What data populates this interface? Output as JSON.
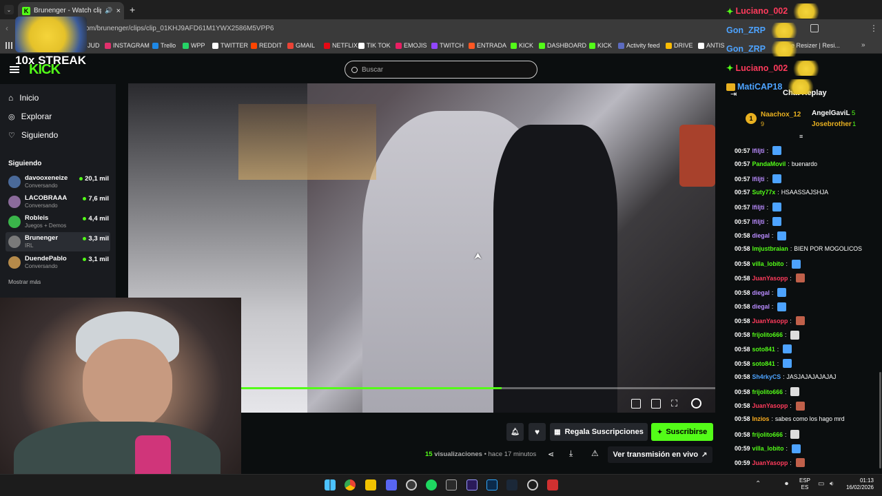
{
  "browser": {
    "tab_title": "Brunenger - Watch clips o",
    "url": "om/brunenger/clips/clip_01KHJ9AFD61M1YWX2586M5VPP6",
    "bookmarks": [
      {
        "label": "JUD",
        "color": "#f5c518"
      },
      {
        "label": "INSTAGRAM",
        "color": "#e1306c"
      },
      {
        "label": "Trello",
        "color": "#1e88e5"
      },
      {
        "label": "WPP",
        "color": "#25d366"
      },
      {
        "label": "TWITTER",
        "color": "#ffffff"
      },
      {
        "label": "REDDIT",
        "color": "#ff4500"
      },
      {
        "label": "GMAIL",
        "color": "#ea4335"
      },
      {
        "label": "NETFLIX",
        "color": "#e50914"
      },
      {
        "label": "TIK TOK",
        "color": "#ffffff"
      },
      {
        "label": "EMOJIS",
        "color": "#e91e63"
      },
      {
        "label": "TWITCH",
        "color": "#9146ff"
      },
      {
        "label": "ENTRADA",
        "color": "#ff5722"
      },
      {
        "label": "KICK",
        "color": "#53fc18"
      },
      {
        "label": "DASHBOARD",
        "color": "#53fc18"
      },
      {
        "label": "KICK",
        "color": "#53fc18"
      },
      {
        "label": "Activity feed",
        "color": "#5c6bc0"
      },
      {
        "label": "DRIVE",
        "color": "#fbbc04"
      },
      {
        "label": "ANTIS",
        "color": "#ffffff"
      },
      {
        "label": "e Resizer | Resi...",
        "color": "#9e9e9e"
      }
    ]
  },
  "overlay": {
    "streak": "10x STREAK",
    "chatters": [
      {
        "name": "Luciano_002",
        "color": "#ff3b5c",
        "icon": "sparkle-icon"
      },
      {
        "name": "Gon_ZRP",
        "color": "#4da3ff",
        "icon": ""
      },
      {
        "name": "Gon_ZRP",
        "color": "#4da3ff",
        "icon": ""
      },
      {
        "name": "Luciano_002",
        "color": "#ff3b5c",
        "icon": "sparkle-icon"
      },
      {
        "name": "MatiCAP18",
        "color": "#4da3ff",
        "icon": "crown-icon"
      }
    ]
  },
  "kick": {
    "logo": "KICK",
    "search_placeholder": "Buscar",
    "nav": [
      {
        "label": "Inicio",
        "icon": "home-icon"
      },
      {
        "label": "Explorar",
        "icon": "compass-icon"
      },
      {
        "label": "Siguiendo",
        "icon": "heart-icon"
      }
    ],
    "following_title": "Siguiendo",
    "channels": [
      {
        "name": "davooxeneize",
        "sub": "Conversando",
        "viewers": "20,1 mil",
        "color": "#4a6a9a"
      },
      {
        "name": "LACOBRAAA",
        "sub": "Conversando",
        "viewers": "7,6 mil",
        "color": "#8a6a9a"
      },
      {
        "name": "Robleis",
        "sub": "Juegos + Demos",
        "viewers": "4,4 mil",
        "color": "#3ab54a"
      },
      {
        "name": "Brunenger",
        "sub": "IRL",
        "viewers": "3,3 mil",
        "color": "#7a7a7a"
      },
      {
        "name": "DuendePablo",
        "sub": "Conversando",
        "viewers": "3,1 mil",
        "color": "#b58a4a"
      }
    ],
    "show_more": "Mostrar más",
    "gift_label": "Regala Suscripciones",
    "subscribe_label": "Suscribirse",
    "views_count": "15",
    "views_label": "visualizaciones",
    "time_ago": "• hace 17 minutos",
    "watch_live": "Ver transmisión en vivo",
    "clip_progress": 0.55
  },
  "chat": {
    "title": "Chat Replay",
    "leaders": [
      {
        "rank": "1",
        "name": "Naachox_12",
        "count": "9"
      },
      {
        "name": "AngelGaviL",
        "count": "5"
      },
      {
        "name": "Josebrother",
        "count": "1"
      }
    ],
    "messages": [
      {
        "time": "00:57",
        "user": "lfiljti",
        "color": "#b98bff",
        "text": "",
        "emote": "#4da3ff"
      },
      {
        "time": "00:57",
        "user": "PandaMovil",
        "color": "#53fc18",
        "text": "buenardo",
        "emote": ""
      },
      {
        "time": "00:57",
        "user": "lfiljti",
        "color": "#b98bff",
        "text": "",
        "emote": "#4da3ff"
      },
      {
        "time": "00:57",
        "user": "Suty77x",
        "color": "#53fc18",
        "text": "HSAASSAJSHJA",
        "emote": ""
      },
      {
        "time": "00:57",
        "user": "lfiljti",
        "color": "#b98bff",
        "text": "",
        "emote": "#4da3ff"
      },
      {
        "time": "00:57",
        "user": "lfiljti",
        "color": "#b98bff",
        "text": "",
        "emote": "#4da3ff"
      },
      {
        "time": "00:58",
        "user": "diegal",
        "color": "#b98bff",
        "text": "",
        "emote": "#4da3ff"
      },
      {
        "time": "00:58",
        "user": "lmjustbraian",
        "color": "#53fc18",
        "text": "BIEN POR MOGOLICOS",
        "emote": ""
      },
      {
        "time": "00:58",
        "user": "villa_lobito",
        "color": "#53fc18",
        "text": "",
        "emote": "#4da3ff"
      },
      {
        "time": "00:58",
        "user": "JuanYasopp",
        "color": "#ff3b5c",
        "text": "",
        "emote": "#c0604a"
      },
      {
        "time": "00:58",
        "user": "diegal",
        "color": "#b98bff",
        "text": "",
        "emote": "#4da3ff"
      },
      {
        "time": "00:58",
        "user": "diegal",
        "color": "#b98bff",
        "text": "",
        "emote": "#4da3ff"
      },
      {
        "time": "00:58",
        "user": "JuanYasopp",
        "color": "#ff3b5c",
        "text": "",
        "emote": "#c0604a"
      },
      {
        "time": "00:58",
        "user": "frijolito666",
        "color": "#53fc18",
        "text": "",
        "emote": "#dddddd"
      },
      {
        "time": "00:58",
        "user": "soto841",
        "color": "#53fc18",
        "text": "",
        "emote": "#4da3ff"
      },
      {
        "time": "00:58",
        "user": "soto841",
        "color": "#53fc18",
        "text": "",
        "emote": "#4da3ff"
      },
      {
        "time": "00:58",
        "user": "Sh4rkyCS",
        "color": "#4da3ff",
        "text": "JASJAJAJAJAJAJ",
        "emote": ""
      },
      {
        "time": "00:58",
        "user": "frijolito666",
        "color": "#53fc18",
        "text": "",
        "emote": "#dddddd"
      },
      {
        "time": "00:58",
        "user": "JuanYasopp",
        "color": "#ff3b5c",
        "text": "",
        "emote": "#c0604a"
      },
      {
        "time": "00:58",
        "user": "Inzios",
        "color": "#ffb020",
        "text": "sabes como los hago mrd",
        "emote": ""
      },
      {
        "time": "00:58",
        "user": "frijolito666",
        "color": "#53fc18",
        "text": "",
        "emote": "#dddddd"
      },
      {
        "time": "00:59",
        "user": "villa_lobito",
        "color": "#53fc18",
        "text": "",
        "emote": "#4da3ff"
      },
      {
        "time": "00:59",
        "user": "JuanYasopp",
        "color": "#ff3b5c",
        "text": "",
        "emote": "#c0604a"
      }
    ]
  },
  "taskbar": {
    "lang_top": "ESP",
    "lang_bottom": "ES",
    "time": "01:13",
    "date": "16/02/2026"
  },
  "colors": {
    "accent": "#53fc18"
  }
}
